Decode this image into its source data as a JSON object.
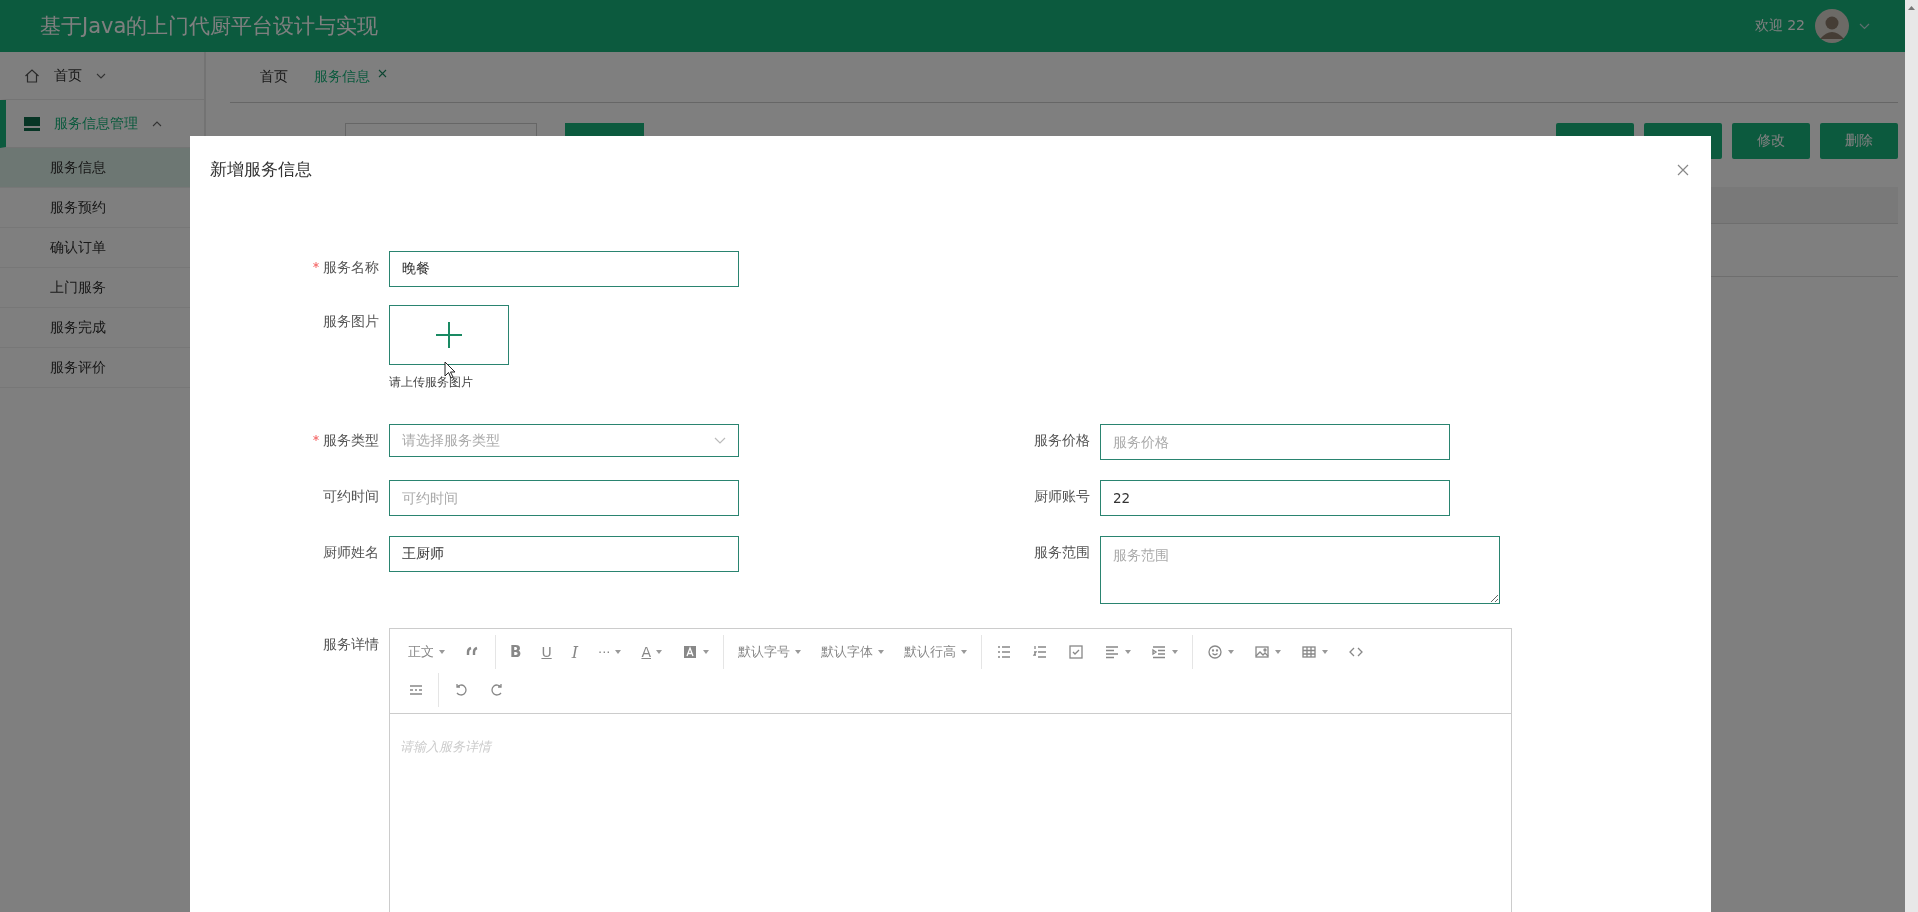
{
  "header": {
    "title": "基于Java的上门代厨平台设计与实现",
    "welcome": "欢迎 22"
  },
  "sidebar": {
    "items": [
      {
        "label": "首页",
        "expanded": false,
        "selected": false
      },
      {
        "label": "服务信息管理",
        "expanded": true,
        "selected": true,
        "children": [
          {
            "label": "服务信息",
            "selected": true
          },
          {
            "label": "服务预约",
            "selected": false
          },
          {
            "label": "确认订单",
            "selected": false
          },
          {
            "label": "上门服务",
            "selected": false
          },
          {
            "label": "服务完成",
            "selected": false
          },
          {
            "label": "服务评价",
            "selected": false
          }
        ]
      }
    ]
  },
  "tabs": [
    {
      "label": "首页",
      "selected": false,
      "closable": false
    },
    {
      "label": "服务信息",
      "selected": true,
      "closable": true
    }
  ],
  "action_buttons": [
    {
      "kind": "covered"
    },
    {
      "kind": "covered"
    },
    {
      "kind": "labelled",
      "label": "修改"
    },
    {
      "kind": "labelled",
      "label": "删除"
    }
  ],
  "dialog": {
    "title": "新增服务信息",
    "top_fields": [
      {
        "label": "服务名称",
        "required": true,
        "kind": "text",
        "value": "晚餐"
      },
      {
        "label": "服务图片",
        "required": false,
        "kind": "upload",
        "hint": "请上传服务图片"
      }
    ],
    "grid_rows": [
      [
        {
          "label": "服务类型",
          "required": true,
          "kind": "select",
          "placeholder": "请选择服务类型"
        },
        {
          "label": "服务价格",
          "required": false,
          "kind": "text",
          "placeholder": "服务价格"
        }
      ],
      [
        {
          "label": "可约时间",
          "required": false,
          "kind": "text",
          "placeholder": "可约时间"
        },
        {
          "label": "厨师账号",
          "required": false,
          "kind": "text",
          "value": "22"
        }
      ],
      [
        {
          "label": "厨师姓名",
          "required": false,
          "kind": "text",
          "value": "王厨师"
        },
        {
          "label": "服务范围",
          "required": false,
          "kind": "textarea",
          "placeholder": "服务范围"
        }
      ]
    ],
    "editor": {
      "label": "服务详情",
      "toolbar_labels": [
        "正文",
        "B",
        "U",
        "I",
        "···",
        "A",
        "默认字号",
        "默认字体",
        "默认行高"
      ],
      "placeholder": "请输入服务详情"
    }
  }
}
